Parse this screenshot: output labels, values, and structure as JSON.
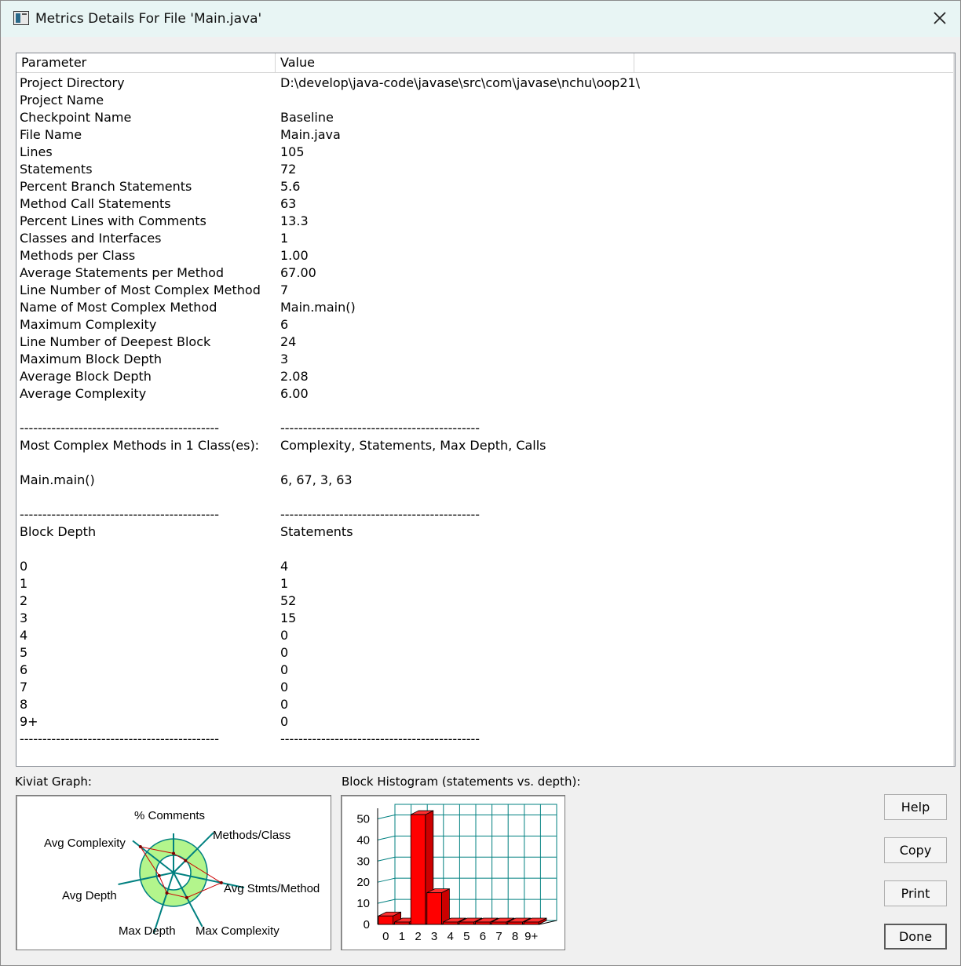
{
  "window": {
    "title": "Metrics Details For File 'Main.java'"
  },
  "table": {
    "columns": [
      "Parameter",
      "Value"
    ],
    "rows": [
      [
        "Project Directory",
        "D:\\develop\\java-code\\javase\\src\\com\\javase\\nchu\\oop21\\"
      ],
      [
        "Project Name",
        ""
      ],
      [
        "Checkpoint Name",
        "Baseline"
      ],
      [
        "File Name",
        "Main.java"
      ],
      [
        "Lines",
        "105"
      ],
      [
        "Statements",
        "72"
      ],
      [
        "Percent Branch Statements",
        "5.6"
      ],
      [
        "Method Call Statements",
        "63"
      ],
      [
        "Percent Lines with Comments",
        "13.3"
      ],
      [
        "Classes and Interfaces",
        "1"
      ],
      [
        "Methods per Class",
        "1.00"
      ],
      [
        "Average Statements per Method",
        "67.00"
      ],
      [
        "Line Number of Most Complex Method",
        "7"
      ],
      [
        "Name of Most Complex Method",
        "Main.main()"
      ],
      [
        "Maximum Complexity",
        "6"
      ],
      [
        "Line Number of Deepest Block",
        "24"
      ],
      [
        "Maximum Block Depth",
        "3"
      ],
      [
        "Average Block Depth",
        "2.08"
      ],
      [
        "Average Complexity",
        "6.00"
      ],
      [
        "",
        ""
      ],
      [
        "--------------------------------------------",
        "--------------------------------------------"
      ],
      [
        "Most Complex Methods in 1 Class(es):",
        "Complexity, Statements, Max Depth, Calls"
      ],
      [
        "",
        ""
      ],
      [
        "Main.main()",
        "6, 67, 3, 63"
      ],
      [
        "",
        ""
      ],
      [
        "--------------------------------------------",
        "--------------------------------------------"
      ],
      [
        "Block Depth",
        "Statements"
      ],
      [
        "",
        ""
      ],
      [
        "0",
        "4"
      ],
      [
        "1",
        "1"
      ],
      [
        "2",
        "52"
      ],
      [
        "3",
        "15"
      ],
      [
        "4",
        "0"
      ],
      [
        "5",
        "0"
      ],
      [
        "6",
        "0"
      ],
      [
        "7",
        "0"
      ],
      [
        "8",
        "0"
      ],
      [
        "9+",
        "0"
      ],
      [
        "--------------------------------------------",
        "--------------------------------------------"
      ]
    ]
  },
  "kiviat": {
    "label": "Kiviat Graph:",
    "axes": [
      "% Comments",
      "Methods/Class",
      "Avg Stmts/Method",
      "Max Complexity",
      "Max Depth",
      "Avg Depth",
      "Avg Complexity"
    ]
  },
  "histogram": {
    "label": "Block Histogram (statements vs. depth):"
  },
  "buttons": {
    "help": "Help",
    "copy": "Copy",
    "print": "Print",
    "done": "Done"
  },
  "chart_data": {
    "type": "bar",
    "categories": [
      "0",
      "1",
      "2",
      "3",
      "4",
      "5",
      "6",
      "7",
      "8",
      "9+"
    ],
    "values": [
      4,
      1,
      52,
      15,
      0,
      0,
      0,
      0,
      0,
      0
    ],
    "ylim": [
      0,
      55
    ],
    "yticks": [
      0,
      10,
      20,
      30,
      40,
      50
    ],
    "grid": true,
    "bar_color": "#ff0000",
    "grid_color": "#008080"
  },
  "colors": {
    "kiviat_ring": "#b3f58c",
    "kiviat_axes": "#008080",
    "kiviat_profile": "#cc0000"
  }
}
